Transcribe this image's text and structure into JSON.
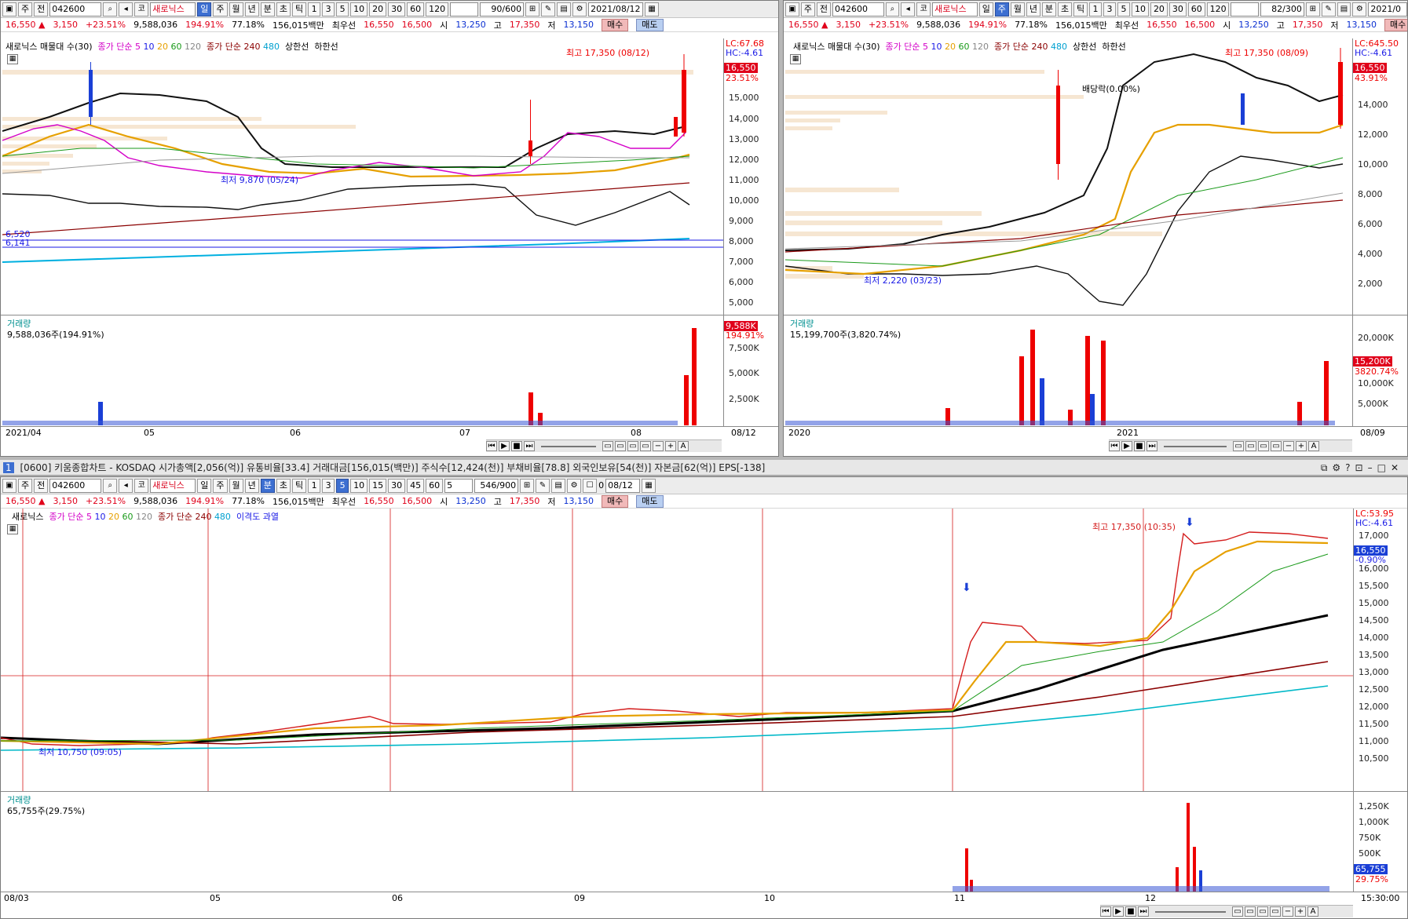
{
  "stock": {
    "code": "042600",
    "name": "새로닉스"
  },
  "quote": {
    "price": "16,550 ▲",
    "change": "3,150",
    "change_pct": "+23.51%",
    "volume": "9,588,036",
    "vol_ratio": "194.91%",
    "turnover_rate": "77.18%",
    "trade_value": "156,015백만",
    "best_ask_label": "최우선",
    "best_ask": "16,550",
    "best_bid": "16,500",
    "open_label": "시",
    "open": "13,250",
    "high_label": "고",
    "high": "17,350",
    "low_label": "저",
    "low": "13,150",
    "buy_label": "매수",
    "sell_label": "매도"
  },
  "toolbar": {
    "type_label": "주",
    "market_label": "전",
    "periods": [
      "일",
      "주",
      "월",
      "년",
      "분",
      "초",
      "틱"
    ],
    "intervals": [
      "1",
      "3",
      "5",
      "10",
      "20",
      "30",
      "60",
      "120"
    ],
    "min_intervals": [
      "1",
      "3",
      "5",
      "10",
      "15",
      "30",
      "45",
      "60"
    ]
  },
  "panel1": {
    "count": "90/600",
    "date": "2021/08/12",
    "legend": {
      "a": "새로닉스 매물대 수(30)",
      "b": "종가 단순 5",
      "n10": "10",
      "n20": "20",
      "n60": "60",
      "n120": "120",
      "c": "종가 단순 240",
      "n480": "480",
      "d": "상한선",
      "e": "하한선"
    },
    "lc": "LC:67.68",
    "hc": "HC:-4.61",
    "price_tag": "16,550",
    "pct_tag": "23.51%",
    "high_note": "최고 17,350 (08/12)",
    "low_note": "최저 9,870 (05/24)",
    "line_tag1": "6,520",
    "line_tag2": "6,141",
    "yaxis": [
      "15,000",
      "14,000",
      "13,000",
      "12,000",
      "11,000",
      "10,000",
      "9,000",
      "8,000",
      "7,000",
      "6,000",
      "5,000"
    ],
    "vol_label": "거래량",
    "vol_value": "9,588,036주(194.91%)",
    "vol_tag": "9,588K",
    "vol_pct_tag": "194.91%",
    "vol_axis": [
      "7,500K",
      "5,000K",
      "2,500K"
    ],
    "dates": [
      "2021/04",
      "05",
      "06",
      "07",
      "08"
    ],
    "last_date": "08/12"
  },
  "panel2": {
    "count": "82/300",
    "date": "2021/0",
    "legend": {
      "a": "새로닉스 매물대 수(30)",
      "b": "종가 단순 5",
      "n10": "10",
      "n20": "20",
      "n60": "60",
      "n120": "120",
      "c": "종가 단순 240",
      "n480": "480",
      "d": "상한선",
      "e": "하한선"
    },
    "lc": "LC:645.50",
    "hc": "HC:-4.61",
    "price_tag": "16,550",
    "pct_tag": "43.91%",
    "high_note": "최고 17,350 (08/09)",
    "low_note": "최저 2,220 (03/23)",
    "div_note": "배당락(0.00%)",
    "yaxis": [
      "14,000",
      "12,000",
      "10,000",
      "8,000",
      "6,000",
      "4,000",
      "2,000"
    ],
    "vol_label": "거래량",
    "vol_value": "15,199,700주(3,820.74%)",
    "vol_tag": "15,200K",
    "vol_pct_tag": "3820.74%",
    "vol_axis": [
      "20,000K",
      "15,000K",
      "10,000K",
      "5,000K"
    ],
    "dates": [
      "2020",
      "2021"
    ],
    "last_date": "08/09"
  },
  "window_title": "[0600] 키움종합차트 - KOSDAQ 시가총액[2,056(억)] 유통비율[33.4] 거래대금[156,015(백만)] 주식수[12,424(천)] 부채비율[78.8] 외국인보유[54(천)] 자본금[62(억)] EPS[-138]",
  "window_num": "1",
  "panel3": {
    "interval_input": "5",
    "count": "546/900",
    "date": "08/12",
    "check_value": "0",
    "legend": {
      "a": "새로닉스",
      "b": "종가 단순 5",
      "n10": "10",
      "n20": "20",
      "n60": "60",
      "n120": "120",
      "c": "종가 단순 240",
      "n480": "480",
      "d": "이격도 과열"
    },
    "lc": "LC:53.95",
    "hc": "HC:-4.61",
    "price_tag": "16,550",
    "pct_tag": "-0.90%",
    "high_note": "최고 17,350 (10:35)",
    "low_note": "최저 10,750 (09:05)",
    "yaxis": [
      "17,000",
      "16,500",
      "16,000",
      "15,500",
      "15,000",
      "14,500",
      "14,000",
      "13,500",
      "13,000",
      "12,500",
      "12,000",
      "11,500",
      "11,000",
      "10,500"
    ],
    "vol_label": "거래량",
    "vol_value": "65,755주(29.75%)",
    "vol_tag": "65,755",
    "vol_pct_tag": "29.75%",
    "vol_axis": [
      "1,250K",
      "1,000K",
      "750K",
      "500K",
      "250K"
    ],
    "dates": [
      "08/03",
      "05",
      "06",
      "09",
      "10",
      "11",
      "12"
    ],
    "last_time": "15:30:00"
  }
}
